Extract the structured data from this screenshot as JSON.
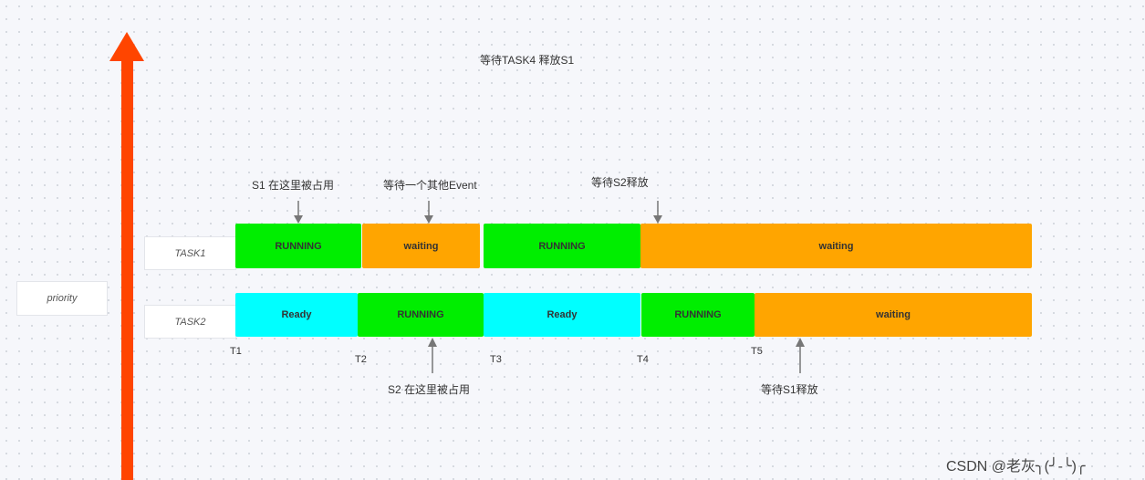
{
  "title": "等待TASK4 释放S1",
  "priority_label": "priority",
  "tasks": [
    {
      "name": "TASK1",
      "segments": [
        {
          "label": "RUNNING",
          "state": "running"
        },
        {
          "label": "waiting",
          "state": "waiting"
        },
        {
          "label": "RUNNING",
          "state": "running"
        },
        {
          "label": "waiting",
          "state": "waiting"
        }
      ]
    },
    {
      "name": "TASK2",
      "segments": [
        {
          "label": "Ready",
          "state": "ready"
        },
        {
          "label": "RUNNING",
          "state": "running"
        },
        {
          "label": "Ready",
          "state": "ready"
        },
        {
          "label": "RUNNING",
          "state": "running"
        },
        {
          "label": "waiting",
          "state": "waiting"
        }
      ]
    }
  ],
  "annotations_top": [
    "S1 在这里被占用",
    "等待一个其他Event",
    "等待S2释放"
  ],
  "annotations_bottom": [
    "S2 在这里被占用",
    "等待S1释放"
  ],
  "time_marks": [
    "T1",
    "T2",
    "T3",
    "T4",
    "T5"
  ],
  "watermark": "CSDN @老灰╮(╯-╰)╭",
  "colors": {
    "running": "#00ee00",
    "waiting": "#ffa500",
    "ready": "#00ffff",
    "priority_arrow": "#ff4500",
    "pointer": "#777777"
  }
}
